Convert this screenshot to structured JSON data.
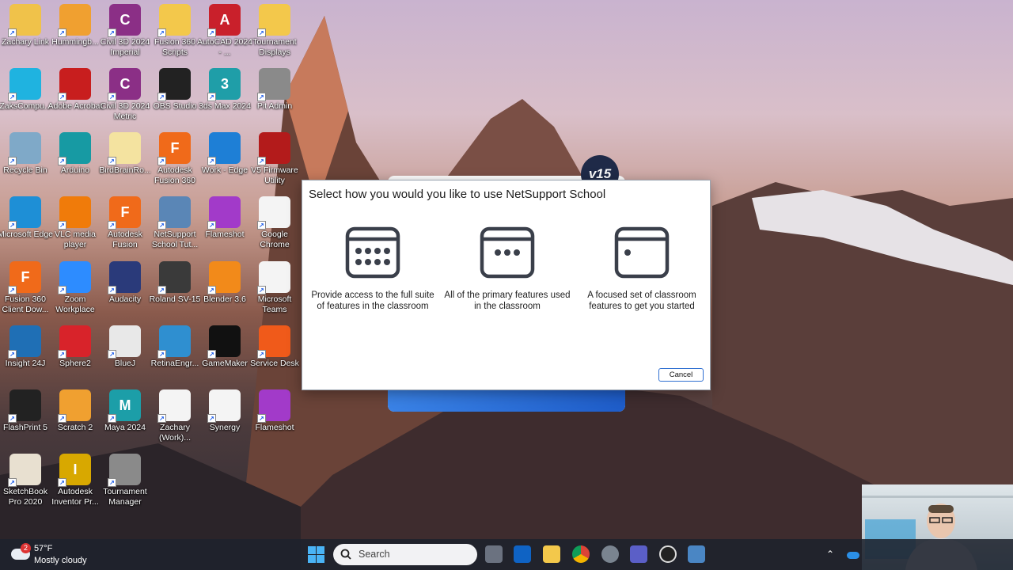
{
  "desktop_icons": [
    {
      "label": "Zachary Link",
      "color": "#f0c24a",
      "glyph": ""
    },
    {
      "label": "Hummingb...",
      "color": "#f0a030",
      "glyph": ""
    },
    {
      "label": "Civil 3D 2024 Imperial",
      "color": "#8b2f86",
      "glyph": "C"
    },
    {
      "label": "Fusion 360 Scripts",
      "color": "#f3c84b",
      "glyph": ""
    },
    {
      "label": "AutoCAD 2024 - ...",
      "color": "#c9202b",
      "glyph": "A"
    },
    {
      "label": "Tournament Displays",
      "color": "#f3c84b",
      "glyph": ""
    },
    {
      "label": "ZaksCompu...",
      "color": "#1fb3e0",
      "glyph": ""
    },
    {
      "label": "Adobe Acrobat",
      "color": "#c81e1e",
      "glyph": ""
    },
    {
      "label": "Civil 3D 2024 Metric",
      "color": "#8b2f86",
      "glyph": "C"
    },
    {
      "label": "OBS Studio",
      "color": "#222222",
      "glyph": ""
    },
    {
      "label": "3ds Max 2024",
      "color": "#1f9ea8",
      "glyph": "3"
    },
    {
      "label": "Pit Admin",
      "color": "#8a8a8a",
      "glyph": ""
    },
    {
      "label": "Recycle Bin",
      "color": "#7fa9c8",
      "glyph": ""
    },
    {
      "label": "Arduino",
      "color": "#179aa3",
      "glyph": ""
    },
    {
      "label": "BirdBrainRo...",
      "color": "#f4e3a0",
      "glyph": ""
    },
    {
      "label": "Autodesk Fusion 360",
      "color": "#f06a1a",
      "glyph": "F"
    },
    {
      "label": "Work - Edge",
      "color": "#1e7fd6",
      "glyph": ""
    },
    {
      "label": "V5 Firmware Utility",
      "color": "#b31b1b",
      "glyph": ""
    },
    {
      "label": "Microsoft Edge",
      "color": "#1e8fd6",
      "glyph": ""
    },
    {
      "label": "VLC media player",
      "color": "#f07b0a",
      "glyph": ""
    },
    {
      "label": "Autodesk Fusion",
      "color": "#f06a1a",
      "glyph": "F"
    },
    {
      "label": "NetSupport School Tut...",
      "color": "#5a86b6",
      "glyph": ""
    },
    {
      "label": "Flameshot",
      "color": "#a23ac9",
      "glyph": ""
    },
    {
      "label": "Google Chrome",
      "color": "#f4f4f4",
      "glyph": ""
    },
    {
      "label": "Fusion 360 Client Dow...",
      "color": "#f06a1a",
      "glyph": "F"
    },
    {
      "label": "Zoom Workplace",
      "color": "#2d8cff",
      "glyph": ""
    },
    {
      "label": "Audacity",
      "color": "#2a3a7a",
      "glyph": ""
    },
    {
      "label": "Roland SV-15",
      "color": "#3a3a3a",
      "glyph": ""
    },
    {
      "label": "Blender 3.6",
      "color": "#f28a1a",
      "glyph": ""
    },
    {
      "label": "Microsoft Teams",
      "color": "#f4f4f4",
      "glyph": ""
    },
    {
      "label": "Insight 24J",
      "color": "#1f6fb5",
      "glyph": ""
    },
    {
      "label": "Sphere2",
      "color": "#d8232a",
      "glyph": ""
    },
    {
      "label": "BlueJ",
      "color": "#e8e8e8",
      "glyph": ""
    },
    {
      "label": "RetinaEngr...",
      "color": "#2f8fd0",
      "glyph": ""
    },
    {
      "label": "GameMaker",
      "color": "#111111",
      "glyph": ""
    },
    {
      "label": "Service Desk",
      "color": "#f05a1a",
      "glyph": ""
    },
    {
      "label": "FlashPrint 5",
      "color": "#222222",
      "glyph": ""
    },
    {
      "label": "Scratch 2",
      "color": "#f0a030",
      "glyph": ""
    },
    {
      "label": "Maya 2024",
      "color": "#1c9ea8",
      "glyph": "M"
    },
    {
      "label": "Zachary (Work)...",
      "color": "#f4f4f4",
      "glyph": ""
    },
    {
      "label": "Synergy",
      "color": "#f4f4f4",
      "glyph": ""
    },
    {
      "label": "Flameshot",
      "color": "#a23ac9",
      "glyph": ""
    },
    {
      "label": "SketchBook Pro 2020",
      "color": "#e8e0d0",
      "glyph": ""
    },
    {
      "label": "Autodesk Inventor Pr...",
      "color": "#d8a800",
      "glyph": "I"
    },
    {
      "label": "Tournament Manager",
      "color": "#8a8a8a",
      "glyph": ""
    }
  ],
  "splash": {
    "version": "v15"
  },
  "dialog": {
    "title": "Select how you would you like to use NetSupport School",
    "options": [
      {
        "text": "Provide access to the full suite of features in the classroom",
        "icon": "grid-full-icon"
      },
      {
        "text": "All of the primary features used in the classroom",
        "icon": "grid-primary-icon"
      },
      {
        "text": "A focused set of classroom features to get you started",
        "icon": "grid-focused-icon"
      }
    ],
    "cancel_label": "Cancel"
  },
  "taskbar": {
    "weather": {
      "badge": "2",
      "temp": "57°F",
      "condition": "Mostly cloudy"
    },
    "search_placeholder": "Search",
    "apps": [
      "task-view",
      "outlook",
      "file-explorer",
      "chrome",
      "settings",
      "teams",
      "obs",
      "netsupport"
    ]
  }
}
